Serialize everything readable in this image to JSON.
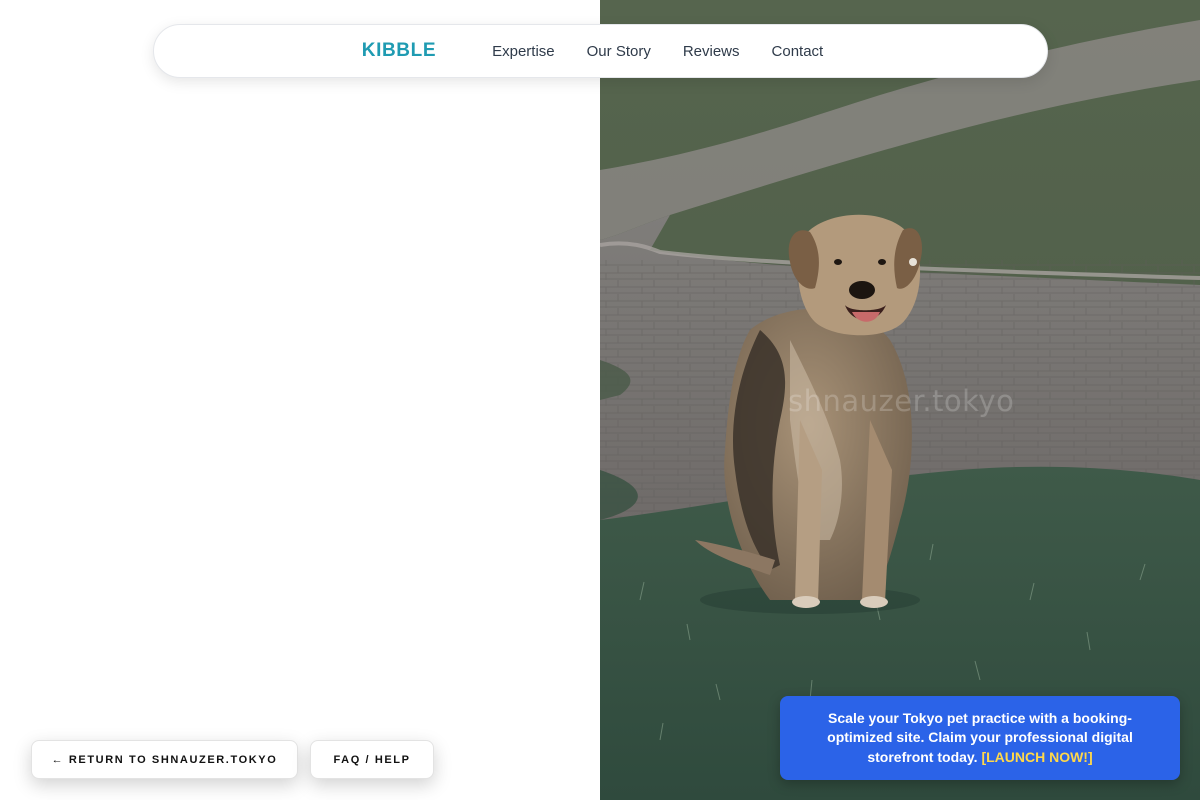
{
  "navbar": {
    "brand": "KIBBLE",
    "links": [
      "Expertise",
      "Our Story",
      "Reviews",
      "Contact"
    ]
  },
  "hero_image": {
    "watermark": "shnauzer.tokyo"
  },
  "buttons": {
    "return_label": "← RETURN TO SHNAUZER.TOKYO",
    "faq_label": "FAQ / HELP"
  },
  "promo": {
    "text": "Scale your Tokyo pet practice with a booking-optimized site. Claim your professional digital storefront today. ",
    "cta": "[LAUNCH NOW!]"
  },
  "colors": {
    "brand": "#1f9bb2",
    "promo_bg": "#2b63e8",
    "promo_cta": "#ffd84a"
  }
}
